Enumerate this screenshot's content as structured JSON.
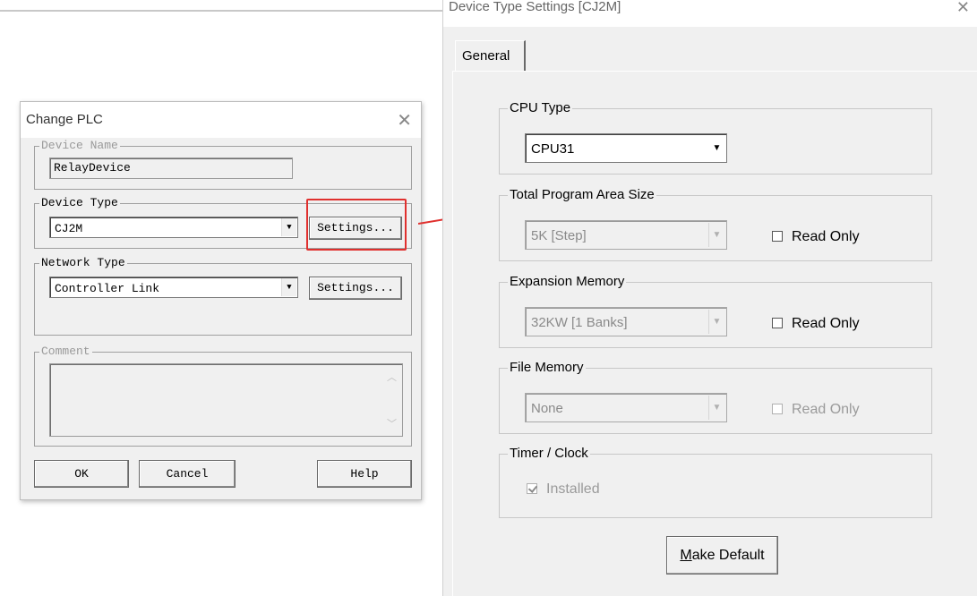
{
  "change_plc": {
    "title": "Change PLC",
    "close_glyph": "✕",
    "device_name": {
      "label": "Device Name",
      "value": "RelayDevice"
    },
    "device_type": {
      "label": "Device Type",
      "value": "CJ2M",
      "settings_label": "Settings..."
    },
    "network_type": {
      "label": "Network Type",
      "value": "Controller Link",
      "settings_label": "Settings..."
    },
    "comment": {
      "label": "Comment",
      "value": ""
    },
    "buttons": {
      "ok": "OK",
      "cancel": "Cancel",
      "help": "Help"
    }
  },
  "device_type_settings": {
    "title": "Device Type Settings [CJ2M]",
    "close_glyph": "✕",
    "tabs": [
      {
        "label": "General",
        "selected": true
      }
    ],
    "cpu_type": {
      "label": "CPU Type",
      "value": "CPU31"
    },
    "program_area": {
      "label": "Total Program Area Size",
      "value": "5K [Step]",
      "read_only_label": "Read Only",
      "read_only_checked": false
    },
    "expansion_memory": {
      "label": "Expansion Memory",
      "value": "32KW [1 Banks]",
      "read_only_label": "Read Only",
      "read_only_checked": false
    },
    "file_memory": {
      "label": "File Memory",
      "value": "None",
      "read_only_label": "Read Only",
      "read_only_checked": false
    },
    "timer_clock": {
      "label": "Timer / Clock",
      "installed_label": "Installed",
      "installed_checked": true
    },
    "make_default": {
      "underlined": "M",
      "rest": "ake Default"
    }
  },
  "colors": {
    "highlight": "#e0302e",
    "dialog_bg": "#f0f0f0"
  }
}
